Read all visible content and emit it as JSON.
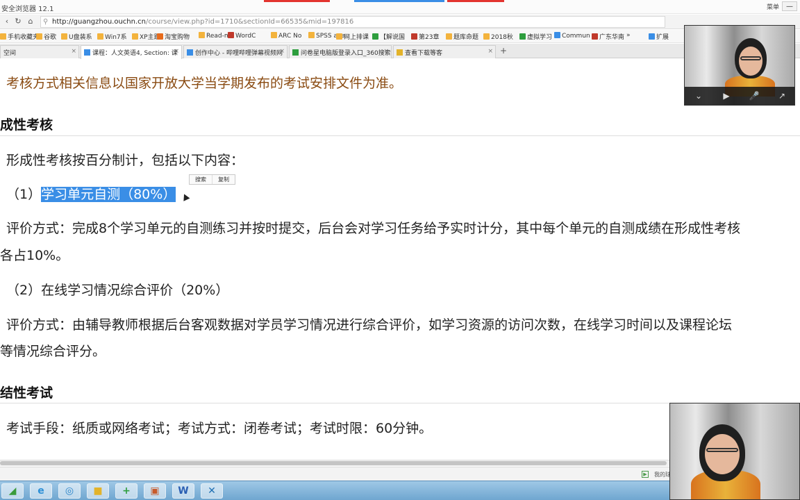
{
  "browser": {
    "app_title": "安全浏览器 12.1",
    "menu_label": "菜单",
    "minimize_label": "—",
    "accent_colors": [
      "#e3342f",
      "#3a8ee6",
      "#e3342f"
    ],
    "url_host": "http://guangzhou.ouchn.cn",
    "url_path": "/course/view.php?id=1710&sectionId=66535&mid=197816",
    "bookmarks": [
      {
        "label": "手机收藏夹",
        "color": "#f3b33d"
      },
      {
        "label": "谷歌",
        "color": "#f3b33d"
      },
      {
        "label": "U盘装系",
        "color": "#f3b33d"
      },
      {
        "label": "Win7系",
        "color": "#f3b33d"
      },
      {
        "label": "XP主题",
        "color": "#f3b33d"
      },
      {
        "label": "淘宝购物",
        "color": "#e76b1c"
      },
      {
        "label": "Read-m",
        "color": "#f3b33d"
      },
      {
        "label": "WordC",
        "color": "#c0392b"
      },
      {
        "label": "ARC No",
        "color": "#f3b33d"
      },
      {
        "label": "SPSS ana",
        "color": "#f3b33d"
      },
      {
        "label": "网上排课",
        "color": "#f3b33d"
      },
      {
        "label": "【解说国",
        "color": "#2e9e3e"
      },
      {
        "label": "第23章",
        "color": "#c0392b"
      },
      {
        "label": "题库命题",
        "color": "#f3b33d"
      },
      {
        "label": "2018秋",
        "color": "#f3b33d"
      },
      {
        "label": "虚拟学习",
        "color": "#2e9e3e"
      },
      {
        "label": "Commun",
        "color": "#3a8ee6"
      },
      {
        "label": "广东华南",
        "color": "#c0392b"
      },
      {
        "label": "»",
        "color": ""
      },
      {
        "label": "扩展",
        "color": "#3a8ee6"
      }
    ],
    "tabs": [
      {
        "label": "空间",
        "active": false
      },
      {
        "label": "课程：人文英语4, Section: 课",
        "active": true
      },
      {
        "label": "创作中心 - 哔哩哔哩弹幕视频网",
        "active": false
      },
      {
        "label": "问卷星电脑版登录入口_360搜索",
        "active": false
      },
      {
        "label": "查看下载等客",
        "active": false
      }
    ],
    "new_tab_label": "+",
    "status_text": "我的球"
  },
  "content": {
    "notice": "考核方式相关信息以国家开放大学当学期发布的考试安排文件为准。",
    "section1_heading": "成性考核",
    "intro": "形成性考核按百分制计，包括以下内容：",
    "item1_prefix": "（1）",
    "item1_selected": "学习单元自测（80%）",
    "popup_search": "搜索",
    "popup_copy": "复制",
    "item1_eval_line1": "评价方式：完成8个学习单元的自测练习并按时提交，后台会对学习任务给予实时计分，其中每个单元的自测成绩在形成性考核",
    "item1_eval_line2": "各占10%。",
    "item2": "（2）在线学习情况综合评价（20%）",
    "item2_eval_line1": "评价方式：由辅导教师根据后台客观数据对学员学习情况进行综合评价，如学习资源的访问次数，在线学习时间以及课程论坛",
    "item2_eval_line2": "等情况综合评分。",
    "section2_heading": "结性考试",
    "exam_line": "考试手段：纸质或网络考试；考试方式：闭卷考试；考试时限：60分钟。"
  },
  "taskbar": {
    "apps": [
      {
        "name": "start-button",
        "glyph": "◢",
        "color": "#3a9b3a"
      },
      {
        "name": "ie-icon",
        "glyph": "e",
        "color": "#2c8fd6"
      },
      {
        "name": "browser-360-icon",
        "glyph": "◎",
        "color": "#2a84c9"
      },
      {
        "name": "folder-icon",
        "glyph": "■",
        "color": "#e3b32a"
      },
      {
        "name": "plus-app-icon",
        "glyph": "+",
        "color": "#2e9e3e"
      },
      {
        "name": "media-icon",
        "glyph": "▣",
        "color": "#c85a2a"
      },
      {
        "name": "word-icon",
        "glyph": "W",
        "color": "#2b5fb3"
      },
      {
        "name": "xmind-icon",
        "glyph": "✕",
        "color": "#1f6fb3"
      }
    ]
  },
  "webcam": {
    "controls": [
      "⌄",
      "▶",
      "🎤",
      "↗"
    ]
  }
}
